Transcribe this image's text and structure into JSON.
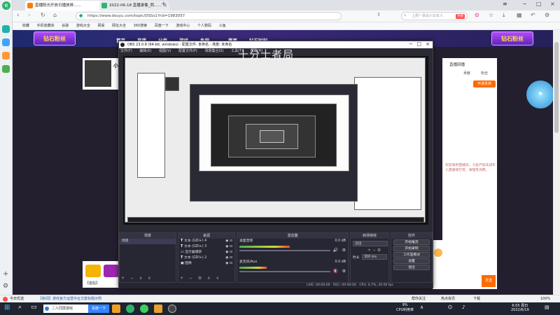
{
  "browser": {
    "tabs": [
      {
        "title": "直播阳光开放日播放排……",
        "active": true
      },
      {
        "title": "2022-06-18 直播录像_西……",
        "active": false
      }
    ],
    "new_tab": "+",
    "address": "https://www.douyu.com/topic/DSSs1?rid=1983057",
    "search_placeholder": "上周一百出小日本人",
    "search_badge": "热搜",
    "bookmarks": [
      "收藏",
      "手机收藏夹",
      "谷歌",
      "游戏大全",
      "网易",
      "网址大全",
      "360搜索",
      "百度一下",
      "游戏中心",
      "个人数码",
      "斗鱼"
    ],
    "status_left": "今日优选",
    "status_news": "【新闻】游戏官方运营中台文案标题示例",
    "status_right_items": [
      "帮你关注",
      "热点资讯",
      "下载",
      "100%"
    ]
  },
  "site": {
    "nav_items": [
      "首页",
      "直播",
      "分类",
      "游戏",
      "鱼吧",
      "赛事",
      "钻石时刻"
    ],
    "banner_left": "钻石粉丝",
    "banner_right": "钻石粉丝",
    "room_name": "小",
    "right_panel_title": "直播回播",
    "right_panel_tabs": [
      "贡献",
      "粉丝"
    ],
    "right_panel_btn": "开通贵族",
    "right_notice": "欢迎来到直播间，斗鱼严禁未成年人直播或打赏，请理性消费。",
    "send_btn": "发送",
    "left_bottom_label": "【首贴】"
  },
  "obs": {
    "title": "OBS 23.0.8 (64-bit, windows) - 配置文件: 未命名 - 场景: 未命名",
    "menu": [
      "文件(F)",
      "编辑(E)",
      "视图(V)",
      "配置文件(P)",
      "场景集合(S)",
      "工具(T)",
      "帮助(H)"
    ],
    "watermark": "十分士者局",
    "docks": {
      "scenes": {
        "title": "场景",
        "items": [
          "场景"
        ]
      },
      "sources": {
        "title": "来源",
        "items": [
          "文本 (GDI+) 4",
          "文本 (GDI+) 3",
          "显示器捕获",
          "文本 (GDI+) 2",
          "图像"
        ]
      },
      "mixer": {
        "title": "混音器",
        "tracks": [
          {
            "name": "桌面音频",
            "db": "0.0 dB",
            "level": 0.55
          },
          {
            "name": "麦克风/Aux",
            "db": "0.0 dB",
            "level": 0.3
          }
        ]
      },
      "transitions": {
        "title": "转场特效",
        "type": "淡出",
        "duration_label": "时长",
        "duration": "300 ms"
      },
      "controls": {
        "title": "控件",
        "buttons": [
          "开始推流",
          "开始录制",
          "工作室模式",
          "设置",
          "退出"
        ]
      }
    },
    "status": {
      "live": "LIVE: 00:00:00",
      "rec": "REC: 00:00:00",
      "cpu": "CPU: 0.7%, 30.00 fps"
    }
  },
  "taskbar": {
    "search_text": "二人同屏游戏",
    "search_btn": "百度一下",
    "tray_cpu": "9%",
    "tray_cpu_label": "CPU利用率",
    "time": "6:05 周日",
    "date": "2022/6/19"
  },
  "colors": {
    "accent": "#ff6a00",
    "site_bg": "#241f2f",
    "obs_bg": "#2a2a35"
  }
}
